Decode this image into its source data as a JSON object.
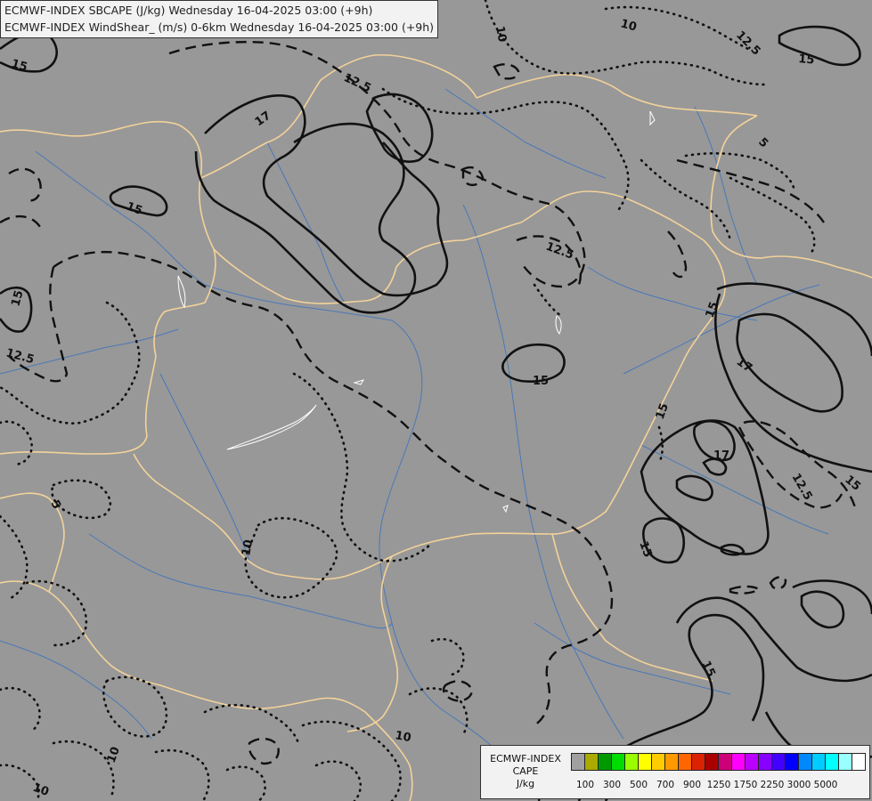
{
  "header": {
    "line1": "ECMWF-INDEX SBCAPE (J/kg) Wednesday 16-04-2025 03:00 (+9h)",
    "line2": "ECMWF-INDEX WindShear_ (m/s) 0-6km Wednesday 16-04-2025 03:00 (+9h)"
  },
  "map": {
    "background_color": "#989898",
    "border_color": "#f3d29a",
    "river_color": "#4a78b8",
    "contour_color": "#111111",
    "contour_labels": [
      {
        "id": "lbl-a",
        "text": "15"
      },
      {
        "id": "lbl-b",
        "text": "10"
      },
      {
        "id": "lbl-c",
        "text": "10"
      },
      {
        "id": "lbl-d",
        "text": "12.5"
      },
      {
        "id": "lbl-e",
        "text": "15"
      },
      {
        "id": "lbl-f",
        "text": "12.5"
      },
      {
        "id": "lbl-g",
        "text": "17"
      },
      {
        "id": "lbl-h",
        "text": "5"
      },
      {
        "id": "lbl-i",
        "text": "15"
      },
      {
        "id": "lbl-j",
        "text": "15"
      },
      {
        "id": "lbl-k",
        "text": "12.5"
      },
      {
        "id": "lbl-l",
        "text": "12.5"
      },
      {
        "id": "lbl-m",
        "text": "15"
      },
      {
        "id": "lbl-n",
        "text": "15"
      },
      {
        "id": "lbl-o",
        "text": "17"
      },
      {
        "id": "lbl-p",
        "text": "15"
      },
      {
        "id": "lbl-q",
        "text": "17"
      },
      {
        "id": "lbl-r",
        "text": "12.5"
      },
      {
        "id": "lbl-s",
        "text": "15"
      },
      {
        "id": "lbl-t",
        "text": "5"
      },
      {
        "id": "lbl-u",
        "text": "10"
      },
      {
        "id": "lbl-v",
        "text": "15"
      },
      {
        "id": "lbl-w",
        "text": "15"
      },
      {
        "id": "lbl-x",
        "text": "10"
      },
      {
        "id": "lbl-y",
        "text": "10"
      },
      {
        "id": "lbl-z",
        "text": "10"
      }
    ]
  },
  "legend": {
    "title_line1": "ECMWF-INDEX",
    "title_line2": "CAPE",
    "title_line3": "J/kg",
    "colors": [
      "#a0a0a0",
      "#aaaa00",
      "#009900",
      "#00dd00",
      "#99ff00",
      "#ffff00",
      "#ffcc00",
      "#ff9900",
      "#ff6600",
      "#dd2200",
      "#aa0000",
      "#cc0077",
      "#ff00ff",
      "#bb00ff",
      "#8800ff",
      "#4400ff",
      "#0000ff",
      "#0088ff",
      "#00ccff",
      "#00ffff",
      "#99ffff",
      "#ffffff"
    ],
    "ticks": [
      "100",
      "300",
      "500",
      "700",
      "900",
      "1250",
      "1750",
      "2250",
      "3000",
      "5000"
    ]
  }
}
